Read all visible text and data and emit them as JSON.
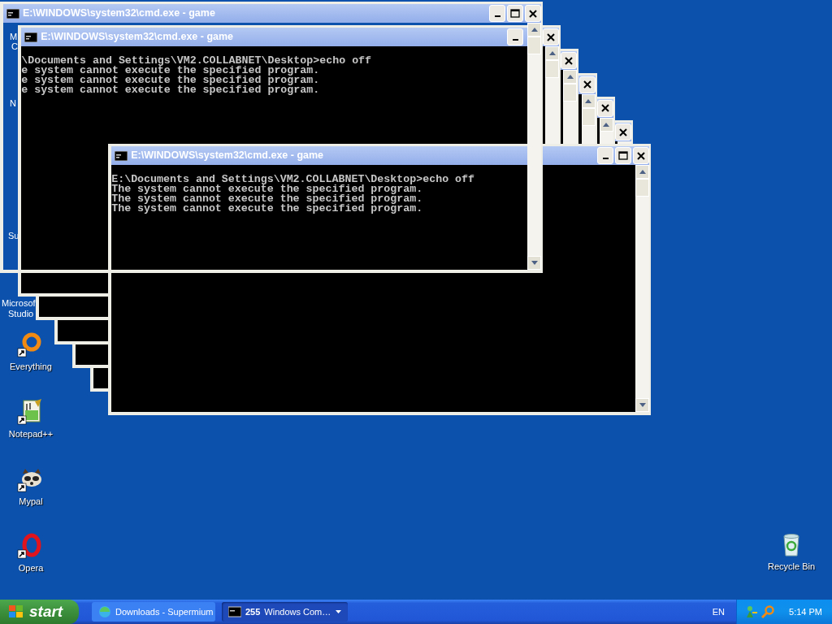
{
  "desktop_label_fragments": [
    {
      "text": "M"
    },
    {
      "text": "C"
    },
    {
      "text": "N"
    },
    {
      "text": "Su"
    },
    {
      "text": "Microsof"
    },
    {
      "text": "Studio"
    }
  ],
  "desktop_icons": [
    {
      "label": "Everything",
      "kind": "everything",
      "shortcut": true
    },
    {
      "label": "Notepad++",
      "kind": "notepad",
      "shortcut": true
    },
    {
      "label": "Mypal",
      "kind": "mypal",
      "shortcut": true
    },
    {
      "label": "Opera",
      "kind": "opera",
      "shortcut": true
    },
    {
      "label": "Recycle Bin",
      "kind": "recycle",
      "shortcut": false
    }
  ],
  "windows": [
    {
      "kind": "ghost",
      "title": "E:\\WINDOWS\\system32\\cmd.exe - game"
    },
    {
      "kind": "stacked",
      "title": "E:\\WINDOWS\\system32\\cmd.exe - game",
      "lines": [
        "\\Documents and Settings\\VM2.COLLABNET\\Desktop>echo off",
        "e system cannot execute the specified program.",
        "e system cannot execute the specified program.",
        "e system cannot execute the specified program."
      ]
    },
    {
      "kind": "stacked"
    },
    {
      "kind": "stacked"
    },
    {
      "kind": "stacked"
    },
    {
      "kind": "stacked"
    },
    {
      "kind": "front",
      "title": "E:\\WINDOWS\\system32\\cmd.exe - game",
      "lines": [
        "E:\\Documents and Settings\\VM2.COLLABNET\\Desktop>echo off",
        "The system cannot execute the specified program.",
        "The system cannot execute the specified program.",
        "The system cannot execute the specified program."
      ]
    }
  ],
  "taskbar": {
    "start": "start",
    "tasks": [
      {
        "kind": "browser",
        "label": "Downloads - Supermium",
        "selected": false
      },
      {
        "kind": "console",
        "count": "255",
        "label": "Windows Com…",
        "selected": true
      }
    ],
    "language": "EN",
    "clock": "5:14 PM"
  }
}
